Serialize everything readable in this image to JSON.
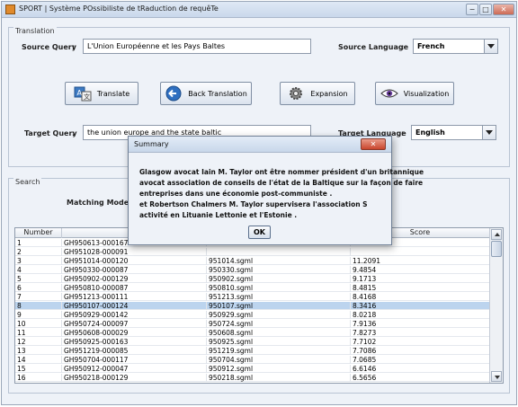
{
  "window": {
    "title": "SPORT | Système POssibiliste de tRaduction de requêTe",
    "controls": {
      "minimize": "−",
      "maximize": "□",
      "close": "✕"
    }
  },
  "translation": {
    "section_title": "Translation",
    "source_query_label": "Source Query",
    "source_query_value": "L'Union Européenne et les Pays Baltes",
    "source_language_label": "Source Language",
    "source_language_value": "French",
    "target_query_label": "Target Query",
    "target_query_value": "the union europe and the state baltic",
    "target_language_label": "Target Language",
    "target_language_value": "English",
    "separator": ":",
    "buttons": {
      "translate": "Translate",
      "back_translation": "Back Translation",
      "expansion": "Expansion",
      "visualization": "Visualization"
    }
  },
  "search": {
    "section_title": "Search",
    "matching_model_label": "Matching Model",
    "table": {
      "columns": [
        "Number",
        "Arti",
        "",
        "Score"
      ],
      "selected_row_index": 7,
      "rows": [
        [
          "1",
          "GH950613-000167",
          "",
          ""
        ],
        [
          "2",
          "GH951028-000091",
          "",
          ""
        ],
        [
          "3",
          "GH951014-000120",
          "951014.sgml",
          "11.2091"
        ],
        [
          "4",
          "GH950330-000087",
          "950330.sgml",
          "9.4854"
        ],
        [
          "5",
          "GH950902-000129",
          "950902.sgml",
          "9.1713"
        ],
        [
          "6",
          "GH950810-000087",
          "950810.sgml",
          "8.4815"
        ],
        [
          "7",
          "GH951213-000111",
          "951213.sgml",
          "8.4168"
        ],
        [
          "8",
          "GH950107-000124",
          "950107.sgml",
          "8.3416"
        ],
        [
          "9",
          "GH950929-000142",
          "950929.sgml",
          "8.0218"
        ],
        [
          "10",
          "GH950724-000097",
          "950724.sgml",
          "7.9136"
        ],
        [
          "11",
          "GH950608-000029",
          "950608.sgml",
          "7.8273"
        ],
        [
          "12",
          "GH950925-000163",
          "950925.sgml",
          "7.7102"
        ],
        [
          "13",
          "GH951219-000085",
          "951219.sgml",
          "7.7086"
        ],
        [
          "14",
          "GH950704-000117",
          "950704.sgml",
          "7.0685"
        ],
        [
          "15",
          "GH950912-000047",
          "950912.sgml",
          "6.6146"
        ],
        [
          "16",
          "GH950218-000129",
          "950218.sgml",
          "6.5656"
        ]
      ]
    }
  },
  "dialog": {
    "title": "Summary",
    "close_label": "✕",
    "lines": [
      "Glasgow avocat Iain M. Taylor ont être nommer président d'un britannique",
      "avocat association de conseils de l'état de la Baltique sur la façon de faire",
      "entreprises dans une économie post-communiste .",
      "et Robertson Chalmers M. Taylor supervisera l'association S",
      "activité en Lituanie Lettonie et l'Estonie ."
    ],
    "ok_label": "OK"
  },
  "colors": {
    "selected_row": "#bcd4ee",
    "window_bg": "#eef2f8",
    "close_button": "#c9452d"
  }
}
